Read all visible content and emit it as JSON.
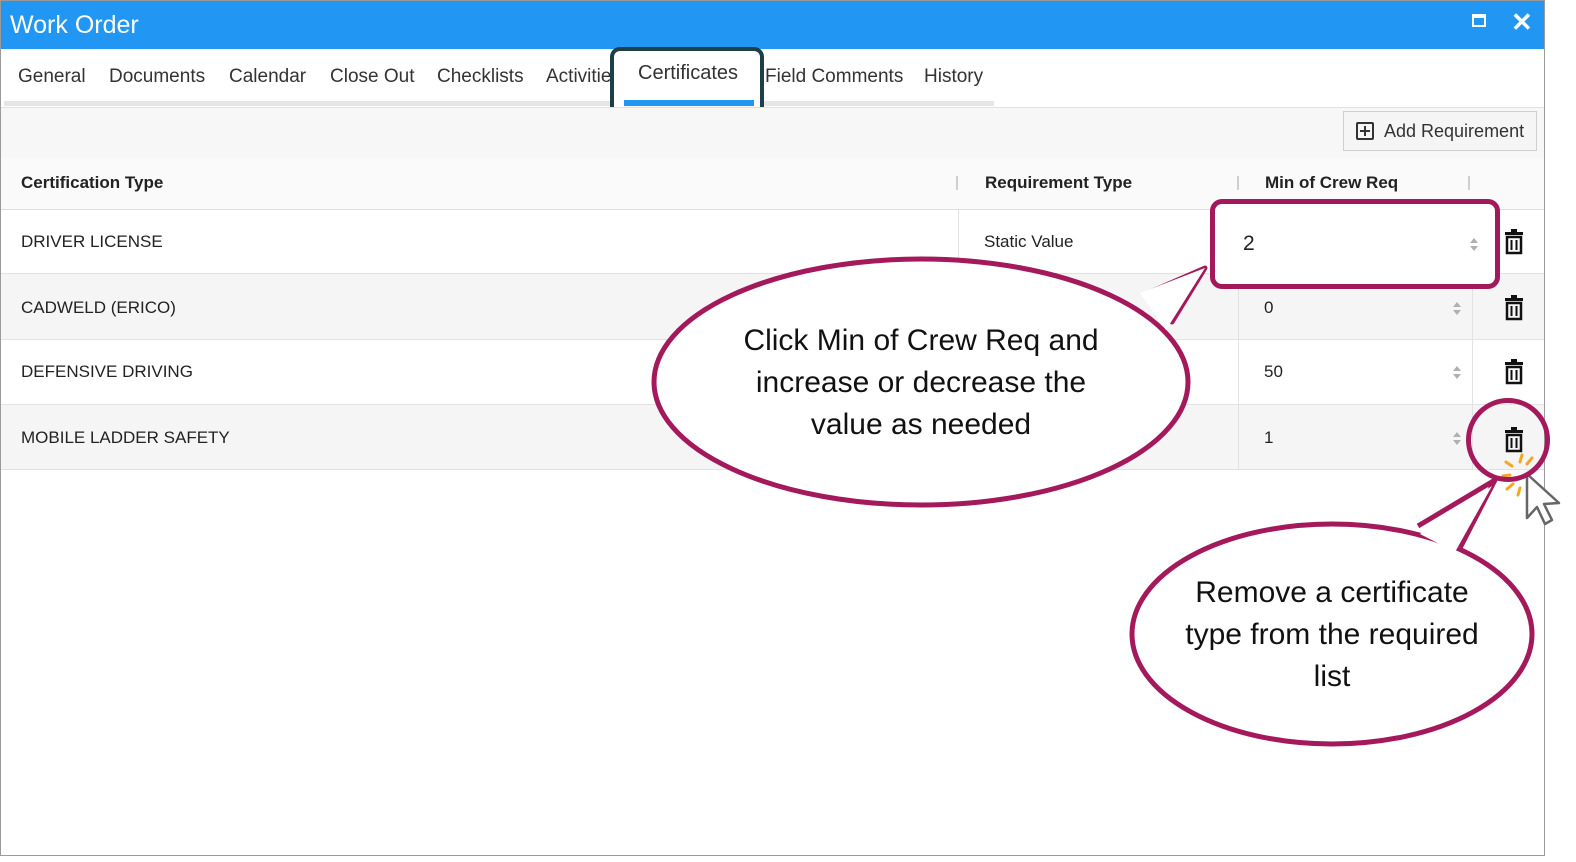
{
  "window": {
    "title": "Work Order"
  },
  "tabs": [
    {
      "label": "General"
    },
    {
      "label": "Documents"
    },
    {
      "label": "Calendar"
    },
    {
      "label": "Close Out"
    },
    {
      "label": "Checklists"
    },
    {
      "label": "Activitie"
    },
    {
      "label": "Certificates",
      "active": true
    },
    {
      "label": "Field Comments"
    },
    {
      "label": "History"
    }
  ],
  "toolbar": {
    "add_requirement_label": "Add Requirement"
  },
  "table": {
    "columns": [
      "Certification Type",
      "Requirement Type",
      "Min of Crew Req"
    ],
    "rows": [
      {
        "certification_type": "DRIVER LICENSE",
        "requirement_type": "Static Value",
        "min_crew_req": "2"
      },
      {
        "certification_type": "CADWELD (ERICO)",
        "requirement_type": "",
        "min_crew_req": "0"
      },
      {
        "certification_type": "DEFENSIVE DRIVING",
        "requirement_type": "",
        "min_crew_req": "50"
      },
      {
        "certification_type": "MOBILE LADDER SAFETY",
        "requirement_type": "",
        "min_crew_req": "1"
      }
    ]
  },
  "callouts": {
    "min_crew": "Click Min of Crew Req and increase or decrease the value as needed",
    "remove": "Remove a certificate type from the required list"
  },
  "colors": {
    "titlebar": "#2196f3",
    "accent": "#2196f3",
    "callout_border": "#a3195b",
    "active_tab_border": "#1f3f48"
  }
}
